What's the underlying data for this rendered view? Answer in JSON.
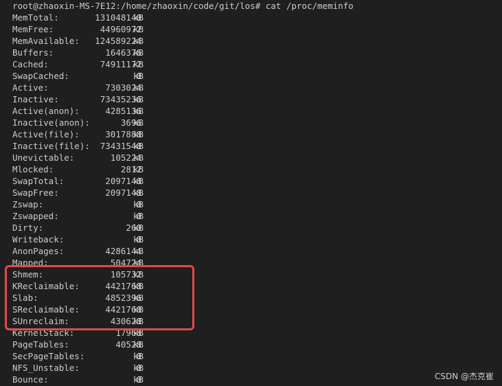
{
  "prompt": "root@zhaoxin-MS-7E12:/home/zhaoxin/code/git/los# cat /proc/meminfo",
  "unit": "kB",
  "rows": [
    {
      "key": "MemTotal:",
      "value": "131048140"
    },
    {
      "key": "MemFree:",
      "value": "44960972"
    },
    {
      "key": "MemAvailable:",
      "value": "124589224"
    },
    {
      "key": "Buffers:",
      "value": "1646376"
    },
    {
      "key": "Cached:",
      "value": "74911172"
    },
    {
      "key": "SwapCached:",
      "value": "0"
    },
    {
      "key": "Active:",
      "value": "7303024"
    },
    {
      "key": "Inactive:",
      "value": "73435236"
    },
    {
      "key": "Active(anon):",
      "value": "4285136"
    },
    {
      "key": "Inactive(anon):",
      "value": "3696"
    },
    {
      "key": "Active(file):",
      "value": "3017888"
    },
    {
      "key": "Inactive(file):",
      "value": "73431540"
    },
    {
      "key": "Unevictable:",
      "value": "105224"
    },
    {
      "key": "Mlocked:",
      "value": "2812"
    },
    {
      "key": "SwapTotal:",
      "value": "2097148"
    },
    {
      "key": "SwapFree:",
      "value": "2097148"
    },
    {
      "key": "Zswap:",
      "value": "0"
    },
    {
      "key": "Zswapped:",
      "value": "0"
    },
    {
      "key": "Dirty:",
      "value": "260"
    },
    {
      "key": "Writeback:",
      "value": "0"
    },
    {
      "key": "AnonPages:",
      "value": "4286144"
    },
    {
      "key": "Mapped:",
      "value": "504724"
    },
    {
      "key": "Shmem:",
      "value": "105732"
    },
    {
      "key": "KReclaimable:",
      "value": "4421768"
    },
    {
      "key": "Slab:",
      "value": "4852396"
    },
    {
      "key": "SReclaimable:",
      "value": "4421768"
    },
    {
      "key": "SUnreclaim:",
      "value": "430628"
    },
    {
      "key": "KernelStack:",
      "value": "17968"
    },
    {
      "key": "PageTables:",
      "value": "40528"
    },
    {
      "key": "SecPageTables:",
      "value": "0"
    },
    {
      "key": "NFS_Unstable:",
      "value": "0"
    },
    {
      "key": "Bounce:",
      "value": "0"
    }
  ],
  "watermark": "CSDN @杰克崔",
  "colors": {
    "background": "#1f1f1f",
    "text": "#cccccc",
    "highlight": "#e5484d"
  }
}
